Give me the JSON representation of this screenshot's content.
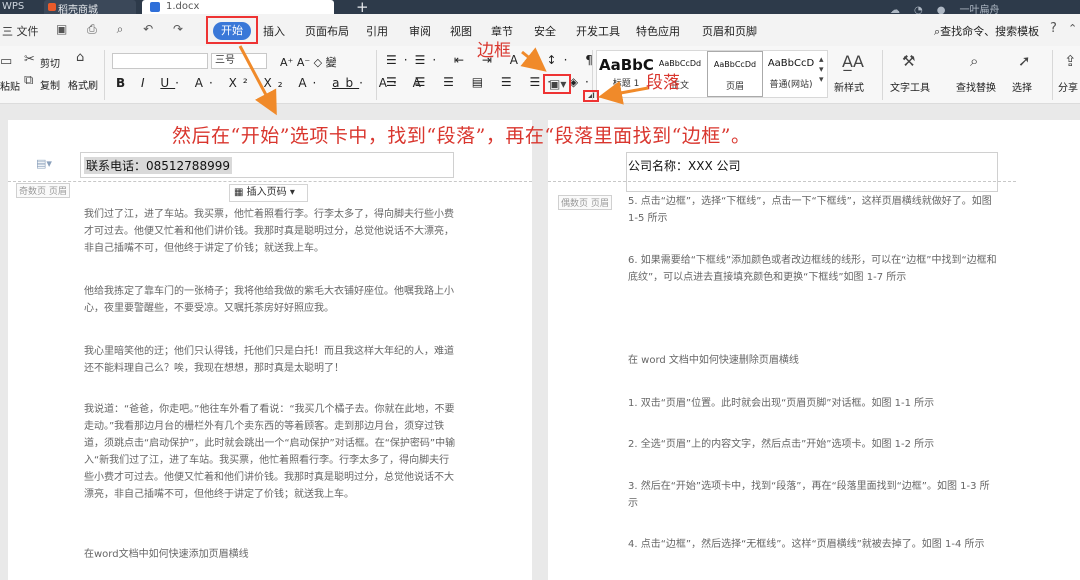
{
  "titlebar": {
    "tab_wps": "WPS",
    "tab_doc1": "稻壳商城",
    "tab_doc2": "1.docx",
    "add_tab": "+",
    "user": "一叶扁舟"
  },
  "menu": {
    "file": "三 文件",
    "quick_icons": "▣ ⎙ ⌕ ↶ ↷",
    "home": "开始",
    "insert": "插入",
    "layout": "页面布局",
    "references": "引用",
    "review": "审阅",
    "view": "视图",
    "chapter": "章节",
    "security": "安全",
    "devtools": "开发工具",
    "features": "特色应用",
    "header_footer": "页眉和页脚",
    "search": "查找命令、搜索模板",
    "help": "?"
  },
  "ribbon": {
    "paste": "粘贴",
    "cut": "剪切",
    "copy": "复制",
    "format_painter": "格式刷",
    "font_size": "三号",
    "styles": [
      {
        "preview": "AaBbC",
        "name": "标题 1"
      },
      {
        "preview": "AaBbCcDd",
        "name": "正文"
      },
      {
        "preview": "AaBbCcDd",
        "name": "页眉"
      },
      {
        "preview": "AaBbCcD",
        "name": "普通(网站)"
      }
    ],
    "new_style": "新样式",
    "text_tools": "文字工具",
    "find_replace": "查找替换",
    "select": "选择",
    "share": "分享"
  },
  "annotations": {
    "main": "然后在“开始”选项卡中，找到“段落”，再在“段落里面找到“边框”。",
    "border": "边框",
    "paragraph": "段落"
  },
  "left_page": {
    "header_text": "联系电话：08512788999",
    "header_tag": "奇数页 页眉",
    "insert_page_number": "插入页码 ▾",
    "paragraphs": [
      "我们过了江，进了车站。我买票，他忙着照看行李。行李太多了，得向脚夫行些小费才可过去。他便又忙着和他们讲价钱。我那时真是聪明过分，总觉他说话不大漂亮，非自己插嘴不可，但他终于讲定了价钱；就送我上车。",
      "他给我拣定了靠车门的一张椅子；我将他给我做的紫毛大衣铺好座位。他嘱我路上小心，夜里要警醒些，不要受凉。又嘱托茶房好好照应我。",
      "我心里暗笑他的迂；他们只认得钱，托他们只是白托！而且我这样大年纪的人，难道还不能料理自己么？唉，我现在想想，那时真是太聪明了！",
      "我说道：“爸爸，你走吧。”他往车外看了看说：“我买几个橘子去。你就在此地，不要走动。”我看那边月台的栅栏外有几个卖东西的等着顾客。走到那边月台，须穿过铁道，须跳点击“启动保护”，此时就会跳出一个“启动保护”对话框。在“保护密码”中输入“新我们过了江，进了车站。我买票，他忙着照看行李。行李太多了，得向脚夫行些小费才可过去。他便又忙着和他们讲价钱。我那时真是聪明过分，总觉他说话不大漂亮，非自己插嘴不可，但他终于讲定了价钱；就送我上车。",
      "在word文档中如何快速添加页眉横线"
    ]
  },
  "right_page": {
    "header_text": "公司名称：XXX 公司",
    "header_tag": "偶数页 页眉",
    "paragraphs": [
      "5. 点击“边框”，选择“下框线”，点击一下“下框线”，这样页眉横线就做好了。如图 1-5 所示",
      "6. 如果需要给“下框线”添加颜色或者改边框线的线形，可以在“边框”中找到“边框和底纹”，可以点进去直接填充颜色和更换“下框线”如图 1-7 所示",
      "在 word 文档中如何快速删除页眉横线",
      "1. 双击“页眉”位置。此时就会出现“页眉页脚”对话框。如图 1-1 所示",
      "2. 全选“页眉”上的内容文字，然后点击”开始”选项卡。如图 1-2 所示",
      "3. 然后在“开始”选项卡中，找到“段落”，再在“段落里面找到“边框”。如图 1-3 所示",
      "4. 点击“边框”，然后选择“无框线”。这样“页眉横线”就被去掉了。如图 1-4 所示"
    ]
  }
}
